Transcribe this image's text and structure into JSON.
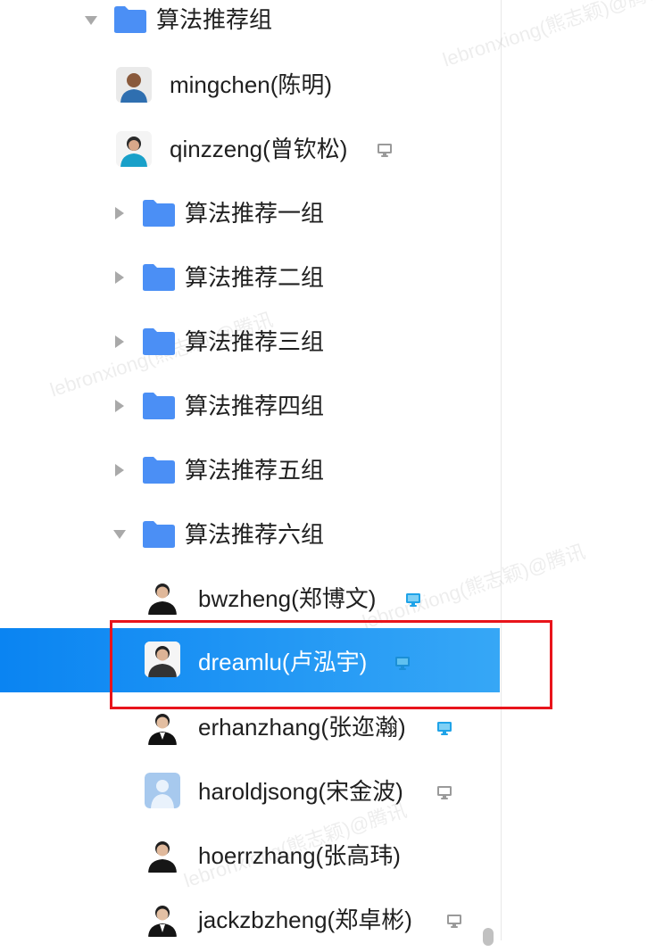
{
  "tree": {
    "root_group": {
      "label": "算法推荐组"
    },
    "members_top": [
      {
        "label": "mingchen(陈明)",
        "avatar": "avatar-photo",
        "device": ""
      },
      {
        "label": "qinzzeng(曾钦松)",
        "avatar": "avatar-photo",
        "device": "pc-gray-icon"
      }
    ],
    "subgroups": [
      {
        "label": "算法推荐一组",
        "state": "collapsed"
      },
      {
        "label": "算法推荐二组",
        "state": "collapsed"
      },
      {
        "label": "算法推荐三组",
        "state": "collapsed"
      },
      {
        "label": "算法推荐四组",
        "state": "collapsed"
      },
      {
        "label": "算法推荐五组",
        "state": "collapsed"
      },
      {
        "label": "算法推荐六组",
        "state": "expanded"
      }
    ],
    "group6_members": [
      {
        "label": "bwzheng(郑博文)",
        "device": "pc-blue-icon"
      },
      {
        "label": "dreamlu(卢泓宇)",
        "device": "pc-blue-icon",
        "selected": true
      },
      {
        "label": "erhanzhang(张迩瀚)",
        "device": "pc-blue-icon"
      },
      {
        "label": "haroldjsong(宋金波)",
        "device": "pc-gray-icon",
        "avatar": "avatar-placeholder"
      },
      {
        "label": "hoerrzhang(张高玮)",
        "device": ""
      },
      {
        "label": "jackzbzheng(郑卓彬)",
        "device": "pc-gray-icon"
      }
    ]
  },
  "watermark": "lebronxiong(熊志颖)@腾讯",
  "colors": {
    "folder": "#4b8ff5",
    "selected_bg": "#1a92f3",
    "pc_blue": "#1fa3e8",
    "pc_gray": "#9a9a9a",
    "highlight": "#e8141b"
  }
}
